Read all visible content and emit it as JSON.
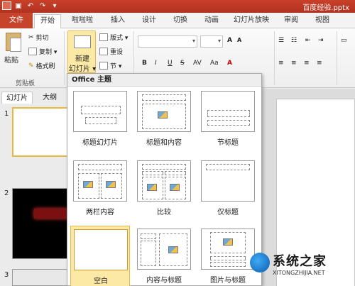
{
  "window": {
    "doc_title": "百度经验.pptx",
    "qat_icons": [
      "save-icon",
      "undo-icon",
      "redo-icon",
      "customize-icon"
    ]
  },
  "tabs": [
    "文件",
    "开始",
    "啦啦啦",
    "插入",
    "设计",
    "切换",
    "动画",
    "幻灯片放映",
    "审阅",
    "视图"
  ],
  "active_tab": "开始",
  "ribbon": {
    "paste": "粘贴",
    "cut": "剪切",
    "copy": "复制 ▾",
    "format_painter": "格式刷",
    "clipboard_group": "剪贴板",
    "new_slide_line1": "新建",
    "new_slide_line2": "幻灯片 ▾",
    "layout": "版式 ▾",
    "reset": "重设",
    "section": "节 ▾"
  },
  "left_panel": {
    "tabs": [
      "幻灯片",
      "大纲"
    ],
    "slide_numbers": [
      "1",
      "2",
      "3"
    ]
  },
  "gallery": {
    "title": "Office 主题",
    "layouts": [
      "标题幻灯片",
      "标题和内容",
      "节标题",
      "两栏内容",
      "比较",
      "仅标题",
      "空白",
      "内容与标题",
      "图片与标题"
    ],
    "selected": "空白"
  },
  "watermark": {
    "name": "系统之家",
    "domain": "XITONGZHIJIA.NET"
  }
}
